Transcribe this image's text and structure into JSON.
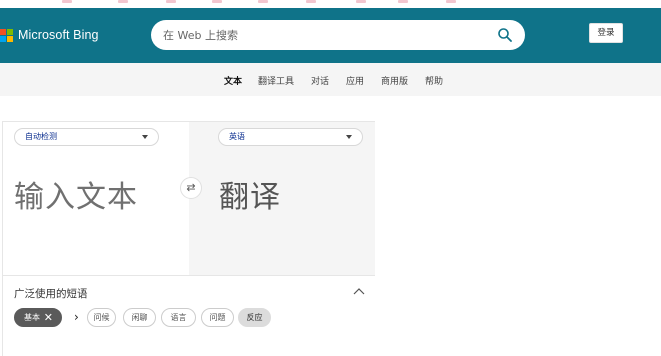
{
  "header": {
    "brand": "Microsoft Bing",
    "search_placeholder": "在 Web 上搜索",
    "signin_label": "登录",
    "colors": {
      "bar": "#0f7389",
      "logo": [
        "#f25022",
        "#7fba00",
        "#00a4ef",
        "#ffb900"
      ]
    }
  },
  "nav": {
    "items": [
      {
        "label": "文本",
        "active": true
      },
      {
        "label": "翻译工具"
      },
      {
        "label": "对话"
      },
      {
        "label": "应用"
      },
      {
        "label": "商用版"
      },
      {
        "label": "帮助"
      }
    ]
  },
  "translator": {
    "source_lang": "自动检测",
    "target_lang": "英语",
    "input_placeholder": "输入文本",
    "output_placeholder": "翻译",
    "swap_icon": "swap-icon"
  },
  "phrases": {
    "title": "广泛使用的短语",
    "selected_chip": "基本",
    "chips": [
      "问候",
      "闲聊",
      "语言",
      "问题",
      "反应"
    ]
  }
}
